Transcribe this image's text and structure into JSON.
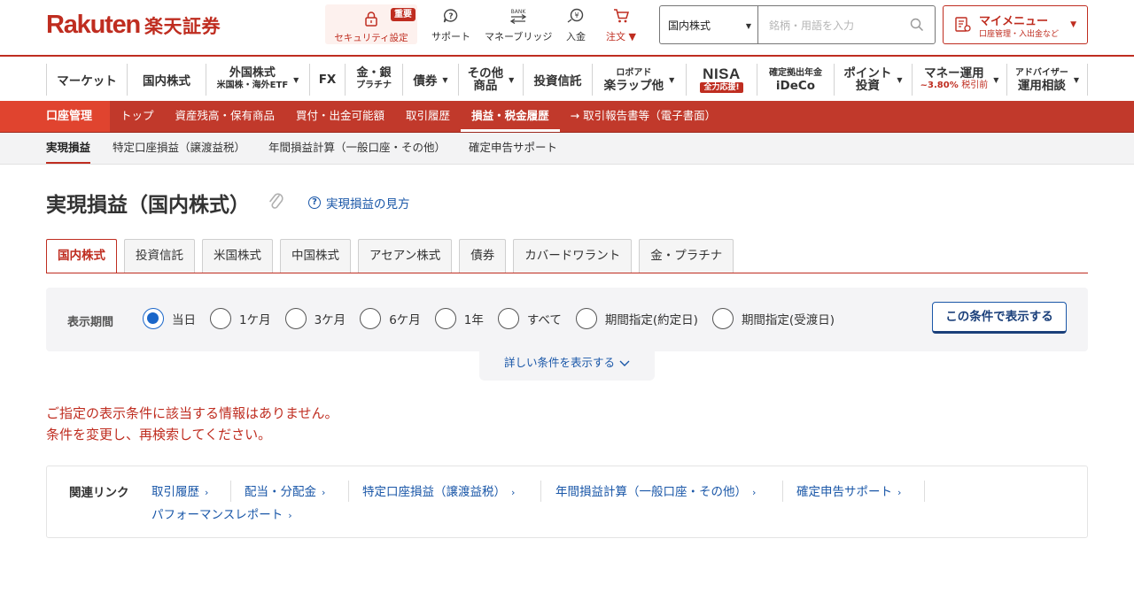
{
  "header": {
    "logo_en": "Rakuten",
    "logo_ja": "楽天証券",
    "security": {
      "badge": "重要",
      "label": "セキュリティ設定"
    },
    "icons": [
      {
        "name": "support-icon",
        "label": "サポート"
      },
      {
        "name": "bank-icon",
        "label": "マネーブリッジ"
      },
      {
        "name": "deposit-icon",
        "label": "入金"
      },
      {
        "name": "cart-icon",
        "label": "注文 ▼"
      }
    ],
    "search": {
      "category": "国内株式",
      "placeholder": "銘柄・用語を入力"
    },
    "mymenu": {
      "title": "マイメニュー",
      "subtitle": "口座管理・入出金など"
    }
  },
  "gnav": {
    "market": "マーケット",
    "domestic": "国内株式",
    "foreign_a": "外国株式",
    "foreign_b": "米国株・海外ETF",
    "fx": "FX",
    "gold_a": "金・銀",
    "gold_b": "プラチナ",
    "bond": "債券",
    "other_a": "その他",
    "other_b": "商品",
    "fund": "投資信託",
    "robo_a": "ロボアド",
    "robo_b": "楽ラップ他",
    "nisa": "NISA",
    "nisa_badge": "全力応援!",
    "ideco_a": "確定拠出年金",
    "ideco_b": "iDeCo",
    "point_a": "ポイント",
    "point_b": "投資",
    "money_a": "マネー運用",
    "money_rate": "~3.80%",
    "money_note": "税引前",
    "advisor_a": "アドバイザー",
    "advisor_b": "運用相談"
  },
  "account_bar": {
    "title": "口座管理",
    "items": [
      "トップ",
      "資産残高・保有商品",
      "買付・出金可能額",
      "取引履歴",
      "損益・税金履歴",
      "取引報告書等（電子書面）"
    ]
  },
  "subnav": [
    "実現損益",
    "特定口座損益（譲渡益税）",
    "年間損益計算（一般口座・その他）",
    "確定申告サポート"
  ],
  "page": {
    "title": "実現損益（国内株式）",
    "help_link": "実現損益の見方"
  },
  "tabs": [
    "国内株式",
    "投資信託",
    "米国株式",
    "中国株式",
    "アセアン株式",
    "債券",
    "カバードワラント",
    "金・プラチナ"
  ],
  "filter": {
    "label": "表示期間",
    "options": [
      "当日",
      "1ケ月",
      "3ケ月",
      "6ケ月",
      "1年",
      "すべて",
      "期間指定(約定日)",
      "期間指定(受渡日)"
    ],
    "selected": "当日",
    "apply": "この条件で表示する",
    "more": "詳しい条件を表示する"
  },
  "message": {
    "line1": "ご指定の表示条件に該当する情報はありません。",
    "line2": "条件を変更し、再検索してください。"
  },
  "related": {
    "label": "関連リンク",
    "links": [
      "取引履歴",
      "配当・分配金",
      "特定口座損益（譲渡益税）",
      "年間損益計算（一般口座・その他）",
      "確定申告サポート",
      "パフォーマンスレポート"
    ]
  },
  "colors": {
    "brand": "#bf2d20",
    "link": "#1a57a8",
    "radio": "#1a66c9"
  }
}
